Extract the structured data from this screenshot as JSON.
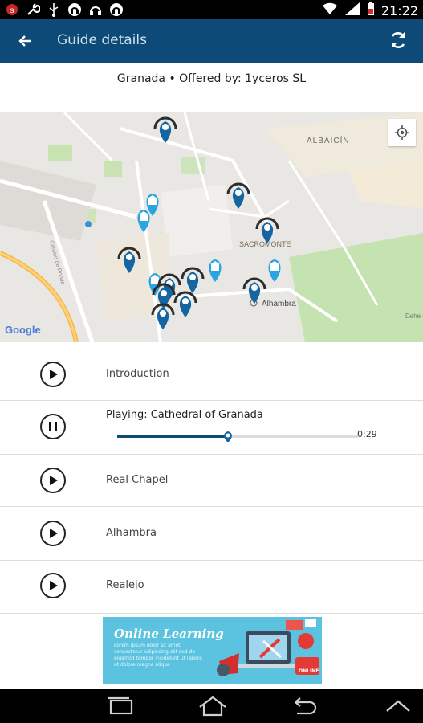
{
  "status_bar": {
    "time": "21:22",
    "left_icons": [
      "app-notification-icon",
      "wrench-icon",
      "usb-icon",
      "headset-icon",
      "headphones-icon",
      "headset-icon"
    ],
    "right_icons": [
      "wifi-icon",
      "signal-icon",
      "battery-icon"
    ]
  },
  "app_bar": {
    "title": "Guide details",
    "back_icon": "back-arrow-icon",
    "refresh_icon": "refresh-icon"
  },
  "guide": {
    "subtitle": "Granada • Offered by: 1yceros SL"
  },
  "map": {
    "labels": {
      "albaicin": "ALBAICÍN",
      "sacromonte": "SACROMONTE",
      "alhambra": "Alhambra",
      "google": "Google",
      "street": "Camino de Ronda",
      "dehesa": "Dehe Gen"
    },
    "locate_icon": "my-location-icon"
  },
  "tracks": [
    {
      "title": "Introduction",
      "state": "play"
    },
    {
      "playing_prefix": "Playing:",
      "title": "Cathedral of Granada",
      "state": "pause",
      "elapsed": "0:29",
      "progress": 0.46
    },
    {
      "title": "Real Chapel",
      "state": "play"
    },
    {
      "title": "Alhambra",
      "state": "play"
    },
    {
      "title": "Realejo",
      "state": "play"
    }
  ],
  "ad": {
    "title": "Online Learning",
    "text": "Lorem ipsum dolor sit amet, consectetur adipiscing elit sed do eiusmod tempor incididunt ut labore et dolore magna aliqua",
    "badge": "ONLINE"
  },
  "nav_bar": {
    "icons": [
      "recent-apps-icon",
      "home-icon",
      "back-icon",
      "up-chevron-icon"
    ]
  },
  "colors": {
    "app_bar": "#0d4a78",
    "pin": "#1565a0",
    "museum_pin": "#2aa5e0",
    "ad_background": "#5bc3df"
  }
}
